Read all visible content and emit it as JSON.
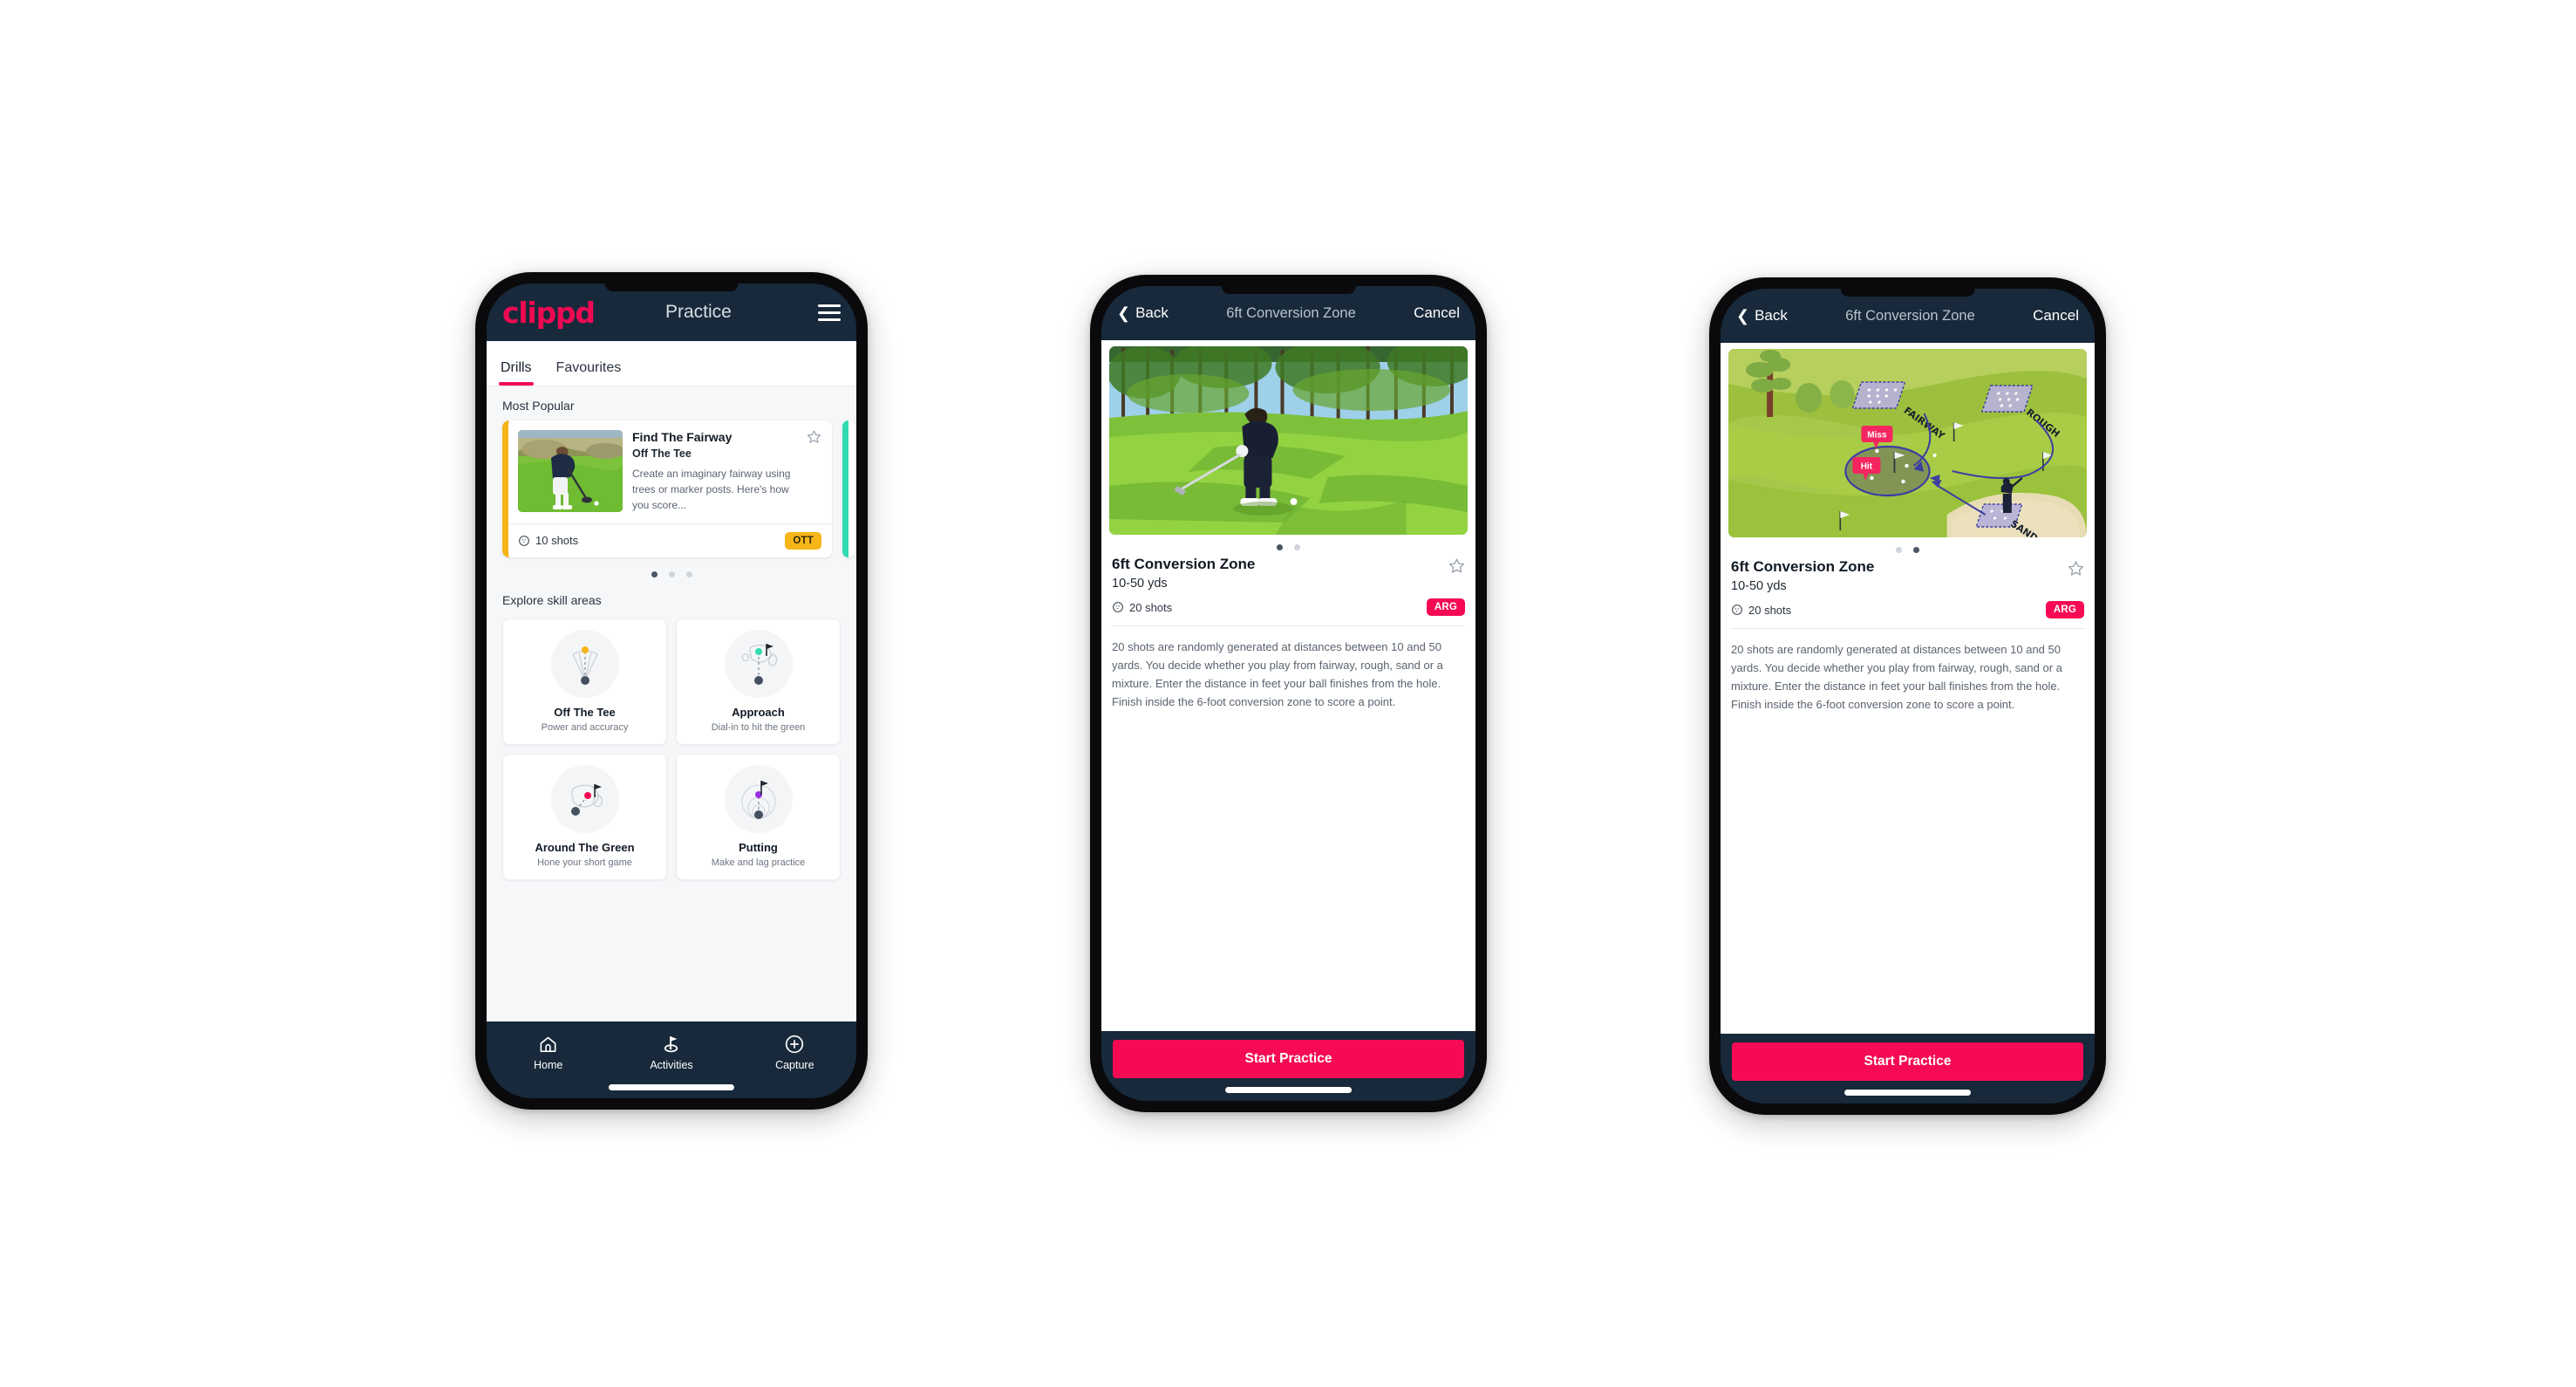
{
  "phone1": {
    "topbar": {
      "brand": "clippd",
      "title": "Practice",
      "menu_icon": "hamburger-icon"
    },
    "tabs": [
      {
        "label": "Drills",
        "active": true
      },
      {
        "label": "Favourites",
        "active": false
      }
    ],
    "sections": {
      "most_popular_title": "Most Popular",
      "explore_title": "Explore skill areas"
    },
    "featured_drill": {
      "name": "Find The Fairway",
      "category": "Off The Tee",
      "description": "Create an imaginary fairway using trees or marker posts. Here's how you score...",
      "shots": "10 shots",
      "badge": "OTT",
      "badge_color": "#f6b519",
      "accent_color": "#f5b417",
      "favourite_icon": "star-outline-icon"
    },
    "carousel_dots": {
      "count": 3,
      "active": 0
    },
    "skill_areas": [
      {
        "name": "Off The Tee",
        "desc": "Power and accuracy",
        "icon": "tee-fan-icon",
        "accent": "#f5b417"
      },
      {
        "name": "Approach",
        "desc": "Dial-in to hit the green",
        "icon": "approach-green-icon",
        "accent": "#31dbb0"
      },
      {
        "name": "Around The Green",
        "desc": "Hone your short game",
        "icon": "chip-green-icon",
        "accent": "#f50a53"
      },
      {
        "name": "Putting",
        "desc": "Make and lag practice",
        "icon": "putting-rings-icon",
        "accent": "#9b30e0"
      }
    ],
    "bottom_nav": [
      {
        "label": "Home",
        "icon": "home-icon",
        "active": false
      },
      {
        "label": "Activities",
        "icon": "golf-flag-icon",
        "active": true
      },
      {
        "label": "Capture",
        "icon": "plus-circle-icon",
        "active": false
      }
    ]
  },
  "phone2": {
    "topbar": {
      "back": "Back",
      "title": "6ft Conversion Zone",
      "cancel": "Cancel",
      "back_icon": "chevron-left-icon"
    },
    "media": {
      "type": "photo",
      "alt_name": "golfer-chipping-photo"
    },
    "carousel_dots": {
      "count": 2,
      "active": 0
    },
    "detail": {
      "name": "6ft Conversion Zone",
      "yards": "10-50 yds",
      "shots": "20 shots",
      "badge": "ARG",
      "badge_color": "#f50a53",
      "favourite_icon": "star-outline-icon",
      "description": "20 shots are randomly generated at distances between 10 and 50 yards. You decide whether you play from fairway, rough, sand or a mixture. Enter the distance in feet your ball finishes from the hole. Finish inside the 6-foot conversion zone to score a point."
    },
    "cta": {
      "label": "Start Practice",
      "color": "#f50a53"
    }
  },
  "phone3": {
    "topbar": {
      "back": "Back",
      "title": "6ft Conversion Zone",
      "cancel": "Cancel",
      "back_icon": "chevron-left-icon"
    },
    "media": {
      "type": "diagram",
      "alt_name": "course-zones-diagram",
      "labels": {
        "fairway": "FAIRWAY",
        "rough": "ROUGH",
        "sand": "SAND",
        "miss": "Miss",
        "hit": "Hit"
      }
    },
    "carousel_dots": {
      "count": 2,
      "active": 1
    },
    "detail": {
      "name": "6ft Conversion Zone",
      "yards": "10-50 yds",
      "shots": "20 shots",
      "badge": "ARG",
      "badge_color": "#f50a53",
      "favourite_icon": "star-outline-icon",
      "description": "20 shots are randomly generated at distances between 10 and 50 yards. You decide whether you play from fairway, rough, sand or a mixture. Enter the distance in feet your ball finishes from the hole. Finish inside the 6-foot conversion zone to score a point."
    },
    "cta": {
      "label": "Start Practice",
      "color": "#f50a53"
    }
  }
}
